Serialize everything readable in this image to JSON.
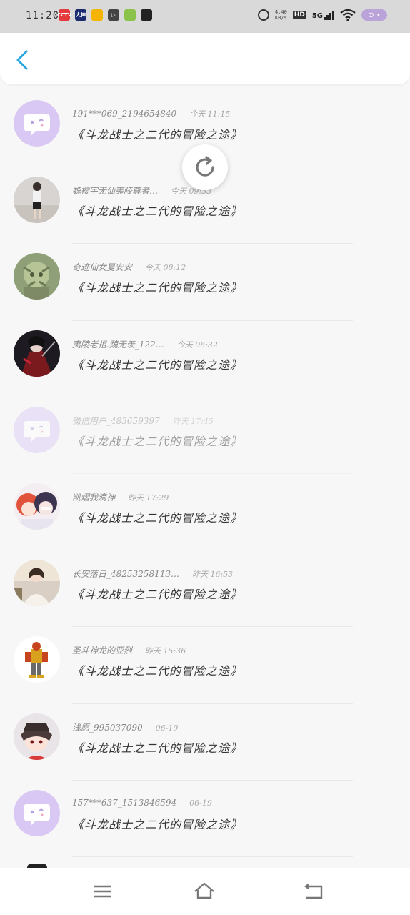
{
  "status_bar": {
    "time": "11:20",
    "speed_top": "4.40",
    "speed_bottom": "KB/s",
    "hd": "HD",
    "network": "5G",
    "apps": [
      {
        "name": "cctv-app-icon",
        "label": "CCTV",
        "color": "#e4393c"
      },
      {
        "name": "dashen-app-icon",
        "label": "大神",
        "color": "#1a2a6c"
      },
      {
        "name": "weibo-app-icon",
        "label": "",
        "color": "#f5b400"
      },
      {
        "name": "play-app-icon",
        "label": "▷",
        "color": "#444444"
      },
      {
        "name": "leaf-app-icon",
        "label": "",
        "color": "#8bc34a"
      },
      {
        "name": "video-app-icon",
        "label": "",
        "color": "#222222"
      }
    ]
  },
  "header": {
    "back_icon": "chevron-left-icon",
    "accent": "#2aa7e0"
  },
  "items": [
    {
      "name": "191***069_2194654840",
      "time": "今天 11:15",
      "title": "《斗龙战士之二代的冒险之途》",
      "avatar": "default"
    },
    {
      "name": "魏樱宇无仙夷陵尊者…",
      "time": "今天 09:33",
      "title": "《斗龙战士之二代的冒险之途》",
      "avatar": "photo-girl"
    },
    {
      "name": "奇迹仙女夏安安",
      "time": "今天 08:12",
      "title": "《斗龙战士之二代的冒险之途》",
      "avatar": "green-fairy"
    },
    {
      "name": "夷陵老祖.魏无羡_122…",
      "time": "今天 06:32",
      "title": "《斗龙战士之二代的冒险之途》",
      "avatar": "dark-warrior"
    },
    {
      "name": "微信用户_483659397",
      "time": "昨天 17:45",
      "title": "《斗龙战士之二代的冒险之途》",
      "avatar": "default",
      "faded": true
    },
    {
      "name": "凯熠我滴神",
      "time": "昨天 17:29",
      "title": "《斗龙战士之二代的冒险之途》",
      "avatar": "anime-pair"
    },
    {
      "name": "长安落日_48253258113…",
      "time": "昨天 16:53",
      "title": "《斗龙战士之二代的冒险之途》",
      "avatar": "photo-person"
    },
    {
      "name": "圣斗神龙的亚烈",
      "time": "昨天 15:36",
      "title": "《斗龙战士之二代的冒险之途》",
      "avatar": "robot"
    },
    {
      "name": "浅愿_995037090",
      "time": "06-19",
      "title": "《斗龙战士之二代的冒险之途》",
      "avatar": "anime-hat"
    },
    {
      "name": "157***637_1513846594",
      "time": "06-19",
      "title": "《斗龙战士之二代的冒险之途》",
      "avatar": "default"
    }
  ],
  "nav": {
    "menu_icon": "menu-icon",
    "home_icon": "home-icon",
    "back_icon": "back-icon"
  }
}
